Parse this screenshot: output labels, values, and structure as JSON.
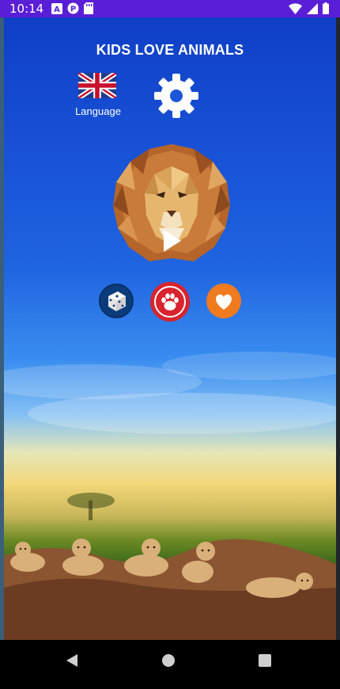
{
  "status_bar": {
    "time": "10:14",
    "left_icons": [
      "a-notification-icon",
      "p-notification-icon",
      "sd-card-icon"
    ],
    "right_icons": [
      "wifi-icon",
      "signal-icon",
      "battery-icon"
    ],
    "color": "#5a1ed6"
  },
  "app": {
    "title": "KIDS LOVE ANIMALS",
    "language": {
      "label": "Language",
      "icon": "uk-flag-icon"
    },
    "settings": {
      "icon": "gear-icon"
    },
    "main": {
      "icon": "lion-play-icon"
    },
    "actions": [
      {
        "name": "dice",
        "icon": "dice-icon",
        "color": "#0a3c7c"
      },
      {
        "name": "paw",
        "icon": "paw-icon",
        "color": "#d9232e"
      },
      {
        "name": "heart",
        "icon": "heart-icon",
        "color": "#f07a1e"
      }
    ]
  },
  "nav_bar": {
    "buttons": [
      "back-icon",
      "home-icon",
      "recents-icon"
    ]
  }
}
